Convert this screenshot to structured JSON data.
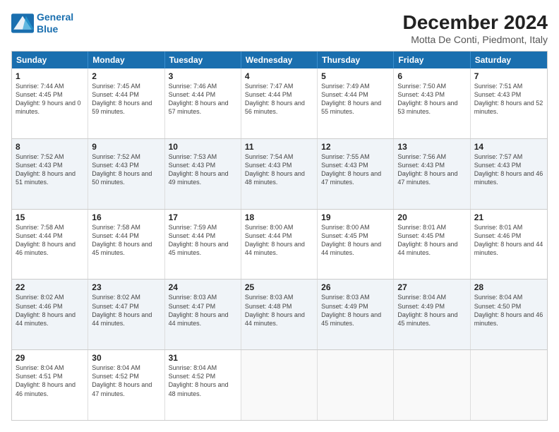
{
  "logo": {
    "line1": "General",
    "line2": "Blue"
  },
  "title": "December 2024",
  "subtitle": "Motta De Conti, Piedmont, Italy",
  "days": [
    "Sunday",
    "Monday",
    "Tuesday",
    "Wednesday",
    "Thursday",
    "Friday",
    "Saturday"
  ],
  "weeks": [
    [
      {
        "day": "1",
        "rise": "7:44 AM",
        "set": "4:45 PM",
        "daylight": "9 hours and 0 minutes."
      },
      {
        "day": "2",
        "rise": "7:45 AM",
        "set": "4:44 PM",
        "daylight": "8 hours and 59 minutes."
      },
      {
        "day": "3",
        "rise": "7:46 AM",
        "set": "4:44 PM",
        "daylight": "8 hours and 57 minutes."
      },
      {
        "day": "4",
        "rise": "7:47 AM",
        "set": "4:44 PM",
        "daylight": "8 hours and 56 minutes."
      },
      {
        "day": "5",
        "rise": "7:49 AM",
        "set": "4:44 PM",
        "daylight": "8 hours and 55 minutes."
      },
      {
        "day": "6",
        "rise": "7:50 AM",
        "set": "4:43 PM",
        "daylight": "8 hours and 53 minutes."
      },
      {
        "day": "7",
        "rise": "7:51 AM",
        "set": "4:43 PM",
        "daylight": "8 hours and 52 minutes."
      }
    ],
    [
      {
        "day": "8",
        "rise": "7:52 AM",
        "set": "4:43 PM",
        "daylight": "8 hours and 51 minutes."
      },
      {
        "day": "9",
        "rise": "7:52 AM",
        "set": "4:43 PM",
        "daylight": "8 hours and 50 minutes."
      },
      {
        "day": "10",
        "rise": "7:53 AM",
        "set": "4:43 PM",
        "daylight": "8 hours and 49 minutes."
      },
      {
        "day": "11",
        "rise": "7:54 AM",
        "set": "4:43 PM",
        "daylight": "8 hours and 48 minutes."
      },
      {
        "day": "12",
        "rise": "7:55 AM",
        "set": "4:43 PM",
        "daylight": "8 hours and 47 minutes."
      },
      {
        "day": "13",
        "rise": "7:56 AM",
        "set": "4:43 PM",
        "daylight": "8 hours and 47 minutes."
      },
      {
        "day": "14",
        "rise": "7:57 AM",
        "set": "4:43 PM",
        "daylight": "8 hours and 46 minutes."
      }
    ],
    [
      {
        "day": "15",
        "rise": "7:58 AM",
        "set": "4:44 PM",
        "daylight": "8 hours and 46 minutes."
      },
      {
        "day": "16",
        "rise": "7:58 AM",
        "set": "4:44 PM",
        "daylight": "8 hours and 45 minutes."
      },
      {
        "day": "17",
        "rise": "7:59 AM",
        "set": "4:44 PM",
        "daylight": "8 hours and 45 minutes."
      },
      {
        "day": "18",
        "rise": "8:00 AM",
        "set": "4:44 PM",
        "daylight": "8 hours and 44 minutes."
      },
      {
        "day": "19",
        "rise": "8:00 AM",
        "set": "4:45 PM",
        "daylight": "8 hours and 44 minutes."
      },
      {
        "day": "20",
        "rise": "8:01 AM",
        "set": "4:45 PM",
        "daylight": "8 hours and 44 minutes."
      },
      {
        "day": "21",
        "rise": "8:01 AM",
        "set": "4:46 PM",
        "daylight": "8 hours and 44 minutes."
      }
    ],
    [
      {
        "day": "22",
        "rise": "8:02 AM",
        "set": "4:46 PM",
        "daylight": "8 hours and 44 minutes."
      },
      {
        "day": "23",
        "rise": "8:02 AM",
        "set": "4:47 PM",
        "daylight": "8 hours and 44 minutes."
      },
      {
        "day": "24",
        "rise": "8:03 AM",
        "set": "4:47 PM",
        "daylight": "8 hours and 44 minutes."
      },
      {
        "day": "25",
        "rise": "8:03 AM",
        "set": "4:48 PM",
        "daylight": "8 hours and 44 minutes."
      },
      {
        "day": "26",
        "rise": "8:03 AM",
        "set": "4:49 PM",
        "daylight": "8 hours and 45 minutes."
      },
      {
        "day": "27",
        "rise": "8:04 AM",
        "set": "4:49 PM",
        "daylight": "8 hours and 45 minutes."
      },
      {
        "day": "28",
        "rise": "8:04 AM",
        "set": "4:50 PM",
        "daylight": "8 hours and 46 minutes."
      }
    ],
    [
      {
        "day": "29",
        "rise": "8:04 AM",
        "set": "4:51 PM",
        "daylight": "8 hours and 46 minutes."
      },
      {
        "day": "30",
        "rise": "8:04 AM",
        "set": "4:52 PM",
        "daylight": "8 hours and 47 minutes."
      },
      {
        "day": "31",
        "rise": "8:04 AM",
        "set": "4:52 PM",
        "daylight": "8 hours and 48 minutes."
      },
      null,
      null,
      null,
      null
    ]
  ],
  "labels": {
    "sunrise": "Sunrise:",
    "sunset": "Sunset:",
    "daylight": "Daylight:"
  }
}
